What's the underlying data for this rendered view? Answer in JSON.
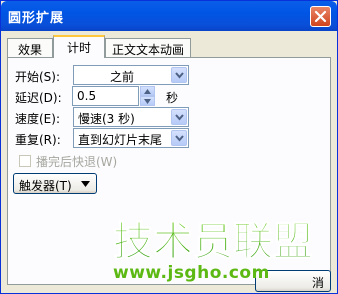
{
  "window": {
    "title": "圆形扩展",
    "close_glyph": "close-icon"
  },
  "tabs": [
    {
      "label": "效果",
      "active": false
    },
    {
      "label": "计时",
      "active": true
    },
    {
      "label": "正文文本动画",
      "active": false
    }
  ],
  "timing": {
    "start": {
      "label": "开始(S):",
      "value": "之前"
    },
    "delay": {
      "label": "延迟(D):",
      "value": "0.5",
      "unit": "秒"
    },
    "speed": {
      "label": "速度(E):",
      "value": "慢速(3 秒)"
    },
    "repeat": {
      "label": "重复(R):",
      "value": "直到幻灯片末尾"
    },
    "rewind": {
      "label": "播完后快退(W)",
      "checked": false,
      "enabled": false
    },
    "trigger_label": "触发器(T)"
  },
  "buttons": {
    "cancel_label": "消"
  },
  "watermark": {
    "logo_text": "技术员联盟",
    "url": "www.jsgho.com"
  },
  "colors": {
    "titlebar": "#0055e5",
    "tab_highlight": "#ffc83c",
    "watermark_green": "#3aa617",
    "watermark_url": "#5cb812"
  }
}
